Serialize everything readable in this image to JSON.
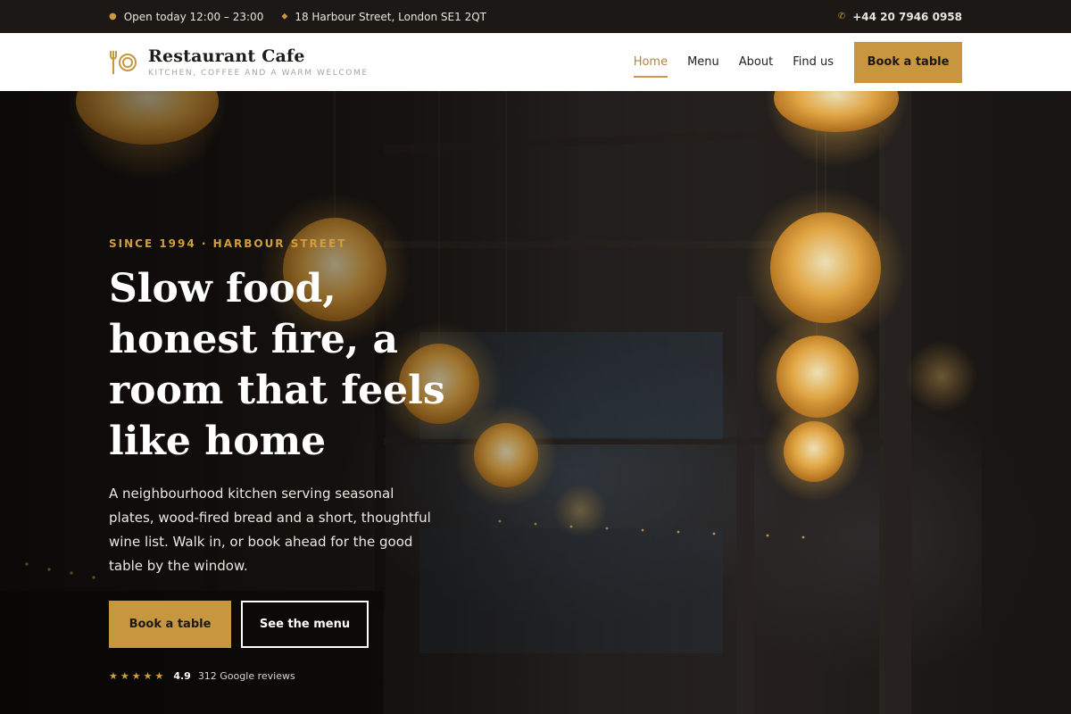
{
  "topbar": {
    "hours_icon": "clock-icon",
    "hours": "Open today 12:00 – 23:00",
    "address_icon": "map-pin-icon",
    "address": "18 Harbour Street, London SE1 2QT",
    "phone_icon": "phone-icon",
    "phone": "+44 20 7946 0958"
  },
  "header": {
    "logo_icon": "fork-plate-icon",
    "brand_name": "Restaurant Cafe",
    "tagline": "KITCHEN, COFFEE AND A WARM WELCOME",
    "nav": [
      {
        "label": "Home",
        "active": true
      },
      {
        "label": "Menu",
        "active": false
      },
      {
        "label": "About",
        "active": false
      },
      {
        "label": "Find us",
        "active": false
      }
    ],
    "cta": "Book a table"
  },
  "hero": {
    "kicker": "SINCE 1994 · HARBOUR STREET",
    "headline": "Slow food, honest fire, a room that feels like home",
    "lede": "A neighbourhood kitchen serving seasonal plates, wood-fired bread and a short, thoughtful wine list. Walk in, or book ahead for the good table by the window.",
    "primary_button": "Book a table",
    "secondary_button": "See the menu",
    "rating": {
      "stars": "★★★★★",
      "score": "4.9",
      "reviews": "312 Google reviews"
    }
  },
  "colors": {
    "accent": "#c8963f",
    "topbar_bg": "#1b1816",
    "header_bg": "#ffffff",
    "hero_bg": "#221c18"
  }
}
